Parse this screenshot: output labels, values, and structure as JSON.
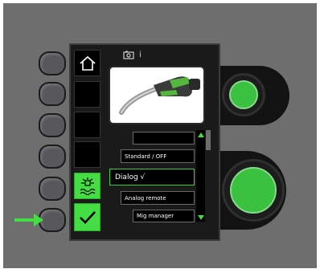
{
  "top_bar": {
    "info_label": "i",
    "camera_icon": "camera-icon"
  },
  "side_tiles": [
    {
      "name": "home",
      "icon": "home-icon"
    },
    {
      "name": "empty-1"
    },
    {
      "name": "empty-2"
    },
    {
      "name": "empty-3"
    },
    {
      "name": "welding-mode",
      "icon": "weld-spark-icon"
    },
    {
      "name": "confirm",
      "icon": "checkmark-icon"
    }
  ],
  "menu": {
    "items": [
      {
        "label": ""
      },
      {
        "label": "Standard / OFF"
      },
      {
        "label": "Dialog √",
        "selected": true
      },
      {
        "label": "Analog remote"
      },
      {
        "label": "Mig manager"
      }
    ]
  },
  "colors": {
    "accent_green": "#44dd44",
    "knob_green": "#39c13f",
    "panel_gray": "#6e6e6e",
    "screen_bg": "#1a1a1a"
  },
  "indicator": "green-arrow"
}
